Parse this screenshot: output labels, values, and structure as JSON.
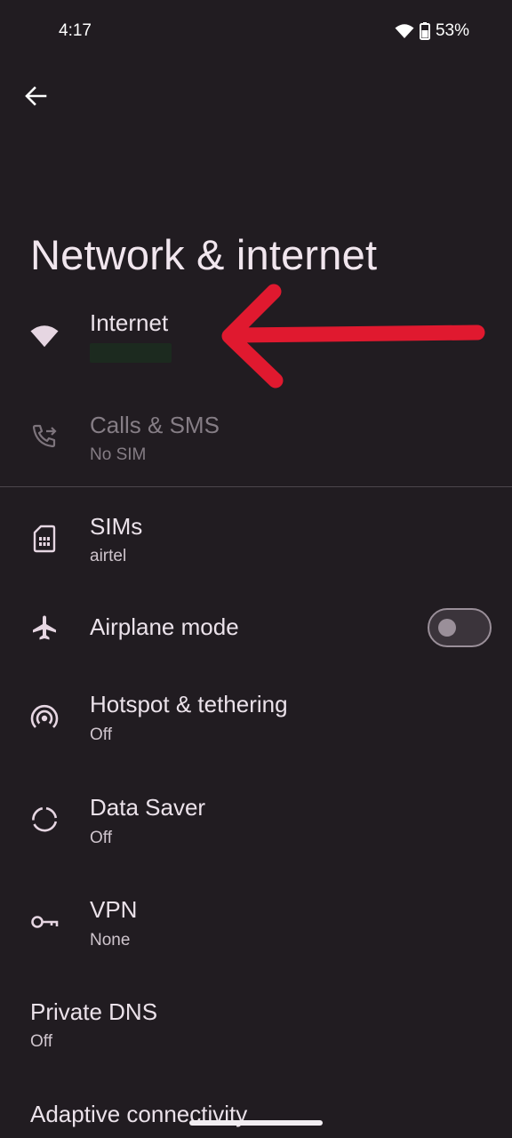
{
  "status_bar": {
    "time": "4:17",
    "battery": "53%",
    "icons": [
      "wifi-icon",
      "battery-icon"
    ]
  },
  "app_bar": {
    "back_icon": "arrow-back-icon",
    "title": "Network & internet"
  },
  "items": [
    {
      "id": "internet",
      "icon": "wifi-icon",
      "title": "Internet",
      "summary": ""
    },
    {
      "id": "calls-sms",
      "icon": "phone-forward-icon",
      "title": "Calls & SMS",
      "summary": "No SIM",
      "disabled": true
    },
    {
      "id": "sims",
      "icon": "sim-card-icon",
      "title": "SIMs",
      "summary": "airtel"
    },
    {
      "id": "airplane-mode",
      "icon": "airplane-icon",
      "title": "Airplane mode",
      "toggle": false
    },
    {
      "id": "hotspot",
      "icon": "hotspot-icon",
      "title": "Hotspot & tethering",
      "summary": "Off"
    },
    {
      "id": "data-saver",
      "icon": "data-saver-icon",
      "title": "Data Saver",
      "summary": "Off"
    },
    {
      "id": "vpn",
      "icon": "key-icon",
      "title": "VPN",
      "summary": "None"
    },
    {
      "id": "private-dns",
      "title": "Private DNS",
      "summary": "Off"
    },
    {
      "id": "adaptive-connectivity",
      "title": "Adaptive connectivity"
    }
  ],
  "colors": {
    "background": "#211c21",
    "text_primary": "#ebe2ea",
    "text_secondary": "#cfc5cd",
    "icon": "#e6d6e2",
    "annotation_arrow": "#e0192f"
  }
}
